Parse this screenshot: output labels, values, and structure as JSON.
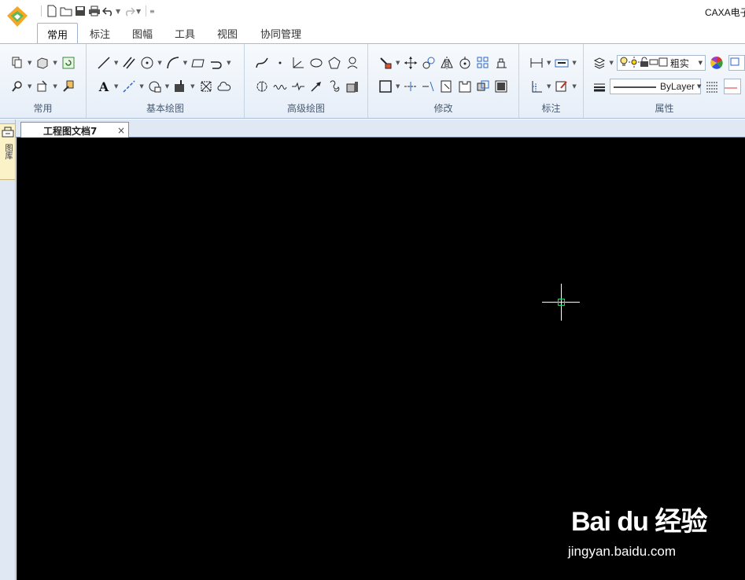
{
  "app": {
    "title": "CAXA电子"
  },
  "quick_access": [
    "new-file-icon",
    "open-folder-icon",
    "save-icon",
    "print-icon",
    "undo-icon",
    "redo-icon",
    "customize-icon"
  ],
  "tabs": [
    {
      "label": "常用",
      "active": true
    },
    {
      "label": "标注",
      "active": false
    },
    {
      "label": "图幅",
      "active": false
    },
    {
      "label": "工具",
      "active": false
    },
    {
      "label": "视图",
      "active": false
    },
    {
      "label": "协同管理",
      "active": false
    }
  ],
  "ribbon": {
    "groups": [
      {
        "label": "常用"
      },
      {
        "label": "基本绘图"
      },
      {
        "label": "高级绘图"
      },
      {
        "label": "修改"
      },
      {
        "label": "标注"
      },
      {
        "label": "属性"
      }
    ],
    "text_tool": "A",
    "properties": {
      "layer_value": "粗实",
      "linetype_value": "ByLayer"
    }
  },
  "side_panel": {
    "label": "图库"
  },
  "document": {
    "tab_title": "工程图文档7",
    "close_glyph": "×"
  },
  "canvas": {
    "background": "#000000",
    "cursor_box_color": "#17e06a"
  },
  "watermark": {
    "logo": "Bai du 经验",
    "url": "jingyan.baidu.com"
  }
}
